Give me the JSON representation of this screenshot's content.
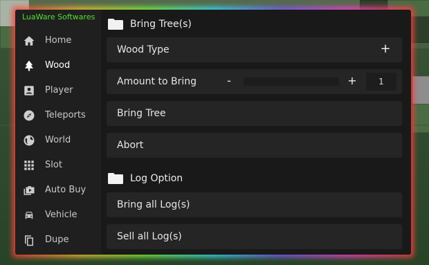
{
  "app": {
    "brand": "LuaWare Softwares",
    "accent_color": "#53e02f"
  },
  "sidebar": {
    "items": [
      {
        "label": "Home",
        "icon": "home-icon",
        "active": false
      },
      {
        "label": "Wood",
        "icon": "tree-icon",
        "active": true
      },
      {
        "label": "Player",
        "icon": "player-icon",
        "active": false
      },
      {
        "label": "Teleports",
        "icon": "compass-icon",
        "active": false
      },
      {
        "label": "World",
        "icon": "globe-icon",
        "active": false
      },
      {
        "label": "Slot",
        "icon": "grid-icon",
        "active": false
      },
      {
        "label": "Auto Buy",
        "icon": "shopping-bag-icon",
        "active": false
      },
      {
        "label": "Vehicle",
        "icon": "car-icon",
        "active": false
      },
      {
        "label": "Dupe",
        "icon": "copy-icon",
        "active": false
      }
    ]
  },
  "main": {
    "sections": [
      {
        "title": "Bring Tree(s)",
        "icon": "folder-icon",
        "rows": [
          {
            "type": "dropdown",
            "label": "Wood Type",
            "action_symbol": "+"
          },
          {
            "type": "slider",
            "label": "Amount to Bring",
            "minus": "-",
            "plus": "+",
            "value": "1",
            "fill_fraction": 0.0
          },
          {
            "type": "button",
            "label": "Bring Tree"
          },
          {
            "type": "button",
            "label": "Abort"
          }
        ]
      },
      {
        "title": "Log Option",
        "icon": "folder-icon",
        "rows": [
          {
            "type": "button",
            "label": "Bring all Log(s)"
          },
          {
            "type": "button",
            "label": "Sell all Log(s)"
          }
        ]
      }
    ]
  }
}
